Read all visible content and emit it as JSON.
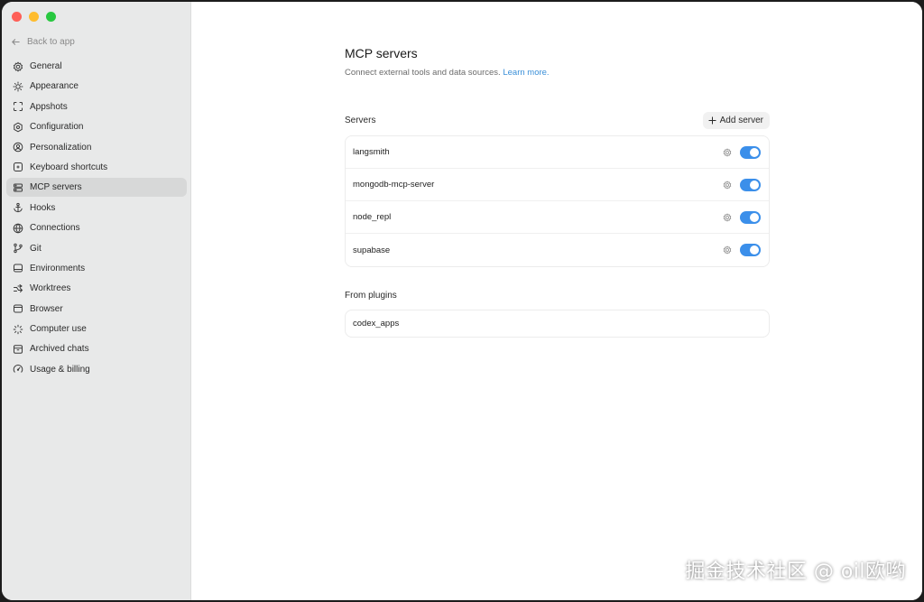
{
  "sidebar": {
    "back_label": "Back to app",
    "items": [
      {
        "label": "General",
        "icon": "gear-icon",
        "active": false
      },
      {
        "label": "Appearance",
        "icon": "sun-icon",
        "active": false
      },
      {
        "label": "Appshots",
        "icon": "frame-icon",
        "active": false
      },
      {
        "label": "Configuration",
        "icon": "config-icon",
        "active": false
      },
      {
        "label": "Personalization",
        "icon": "person-icon",
        "active": false
      },
      {
        "label": "Keyboard shortcuts",
        "icon": "keyboard-icon",
        "active": false
      },
      {
        "label": "MCP servers",
        "icon": "server-icon",
        "active": true
      },
      {
        "label": "Hooks",
        "icon": "anchor-icon",
        "active": false
      },
      {
        "label": "Connections",
        "icon": "globe-icon",
        "active": false
      },
      {
        "label": "Git",
        "icon": "git-branch-icon",
        "active": false
      },
      {
        "label": "Environments",
        "icon": "environment-icon",
        "active": false
      },
      {
        "label": "Worktrees",
        "icon": "worktree-icon",
        "active": false
      },
      {
        "label": "Browser",
        "icon": "browser-icon",
        "active": false
      },
      {
        "label": "Computer use",
        "icon": "sparkle-icon",
        "active": false
      },
      {
        "label": "Archived chats",
        "icon": "archive-icon",
        "active": false
      },
      {
        "label": "Usage & billing",
        "icon": "gauge-icon",
        "active": false
      }
    ]
  },
  "main": {
    "title": "MCP servers",
    "subtitle": "Connect external tools and data sources.",
    "learn_more": "Learn more.",
    "servers_label": "Servers",
    "add_server_label": "Add server",
    "servers": [
      {
        "name": "langsmith",
        "enabled": true
      },
      {
        "name": "mongodb-mcp-server",
        "enabled": true
      },
      {
        "name": "node_repl",
        "enabled": true
      },
      {
        "name": "supabase",
        "enabled": true
      }
    ],
    "plugins_label": "From plugins",
    "plugins": [
      {
        "name": "codex_apps"
      }
    ]
  },
  "colors": {
    "accent": "#3b8fea",
    "link": "#3a8fd8",
    "sidebar_bg": "#e8e9e9"
  },
  "watermark": "掘金技术社区 @ oil欧哟"
}
